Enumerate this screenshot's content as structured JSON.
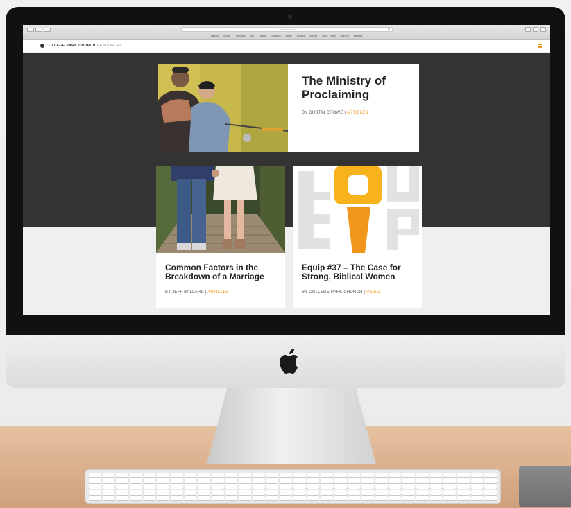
{
  "browser": {
    "url": "cpcresources.net",
    "bookmarks": [
      "Banking",
      "Google",
      "Teamwork",
      "Box",
      "Longtail",
      "Shopping",
      "Lattice",
      "Dribbble",
      "Adverts",
      "Apply Pixels",
      "GetFloor",
      "Behance"
    ]
  },
  "site": {
    "logo_bold": "COLLEGE PARK CHURCH",
    "logo_light": "RESOURCES",
    "accent_color": "#f0961a"
  },
  "featured": {
    "title": "The Ministry of Proclaiming",
    "byline": "BY DUSTIN CROWE",
    "separator": " | ",
    "category": "ARTICLES"
  },
  "cards": [
    {
      "title": "Common Factors in the Breakdown of a Marriage",
      "byline": "BY JEFF BALLARD",
      "separator": " | ",
      "category": "ARTICLES"
    },
    {
      "title": "Equip #37 – The Case for Strong, Biblical Women",
      "byline": "BY COLLEGE PARK CHURCH",
      "separator": " | ",
      "category": "VIDEO",
      "art_letters": [
        "E",
        "Q",
        "U",
        "I",
        "P"
      ]
    }
  ]
}
